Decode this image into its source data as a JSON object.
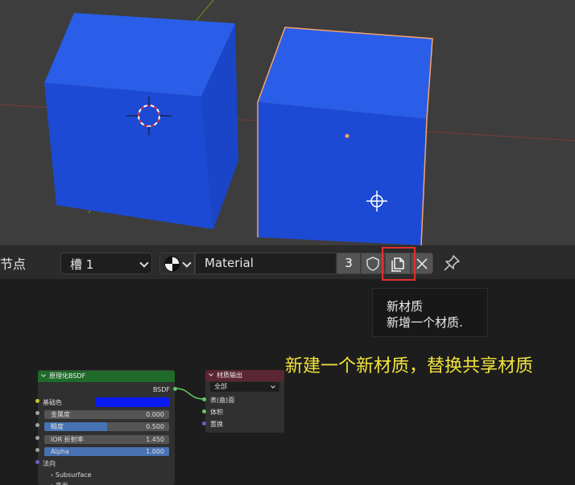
{
  "header": {
    "panel_label": "节点",
    "slot": "槽 1",
    "material_name": "Material",
    "user_count": "3"
  },
  "tooltip": {
    "title": "新材质",
    "description": "新增一个材质."
  },
  "annotation": {
    "caption": "新建一个新材质，替换共享材质",
    "highlight_color": "#e23030",
    "caption_color": "#f2e33b"
  },
  "nodes": {
    "bsdf": {
      "title": "原理化BSDF",
      "output": "BSDF",
      "base_color_label": "基础色",
      "base_color": "#0a1af2",
      "fields": [
        {
          "label": "金属度",
          "value": "0.000",
          "fill": 0
        },
        {
          "label": "糙度",
          "value": "0.500",
          "fill": 0.5
        },
        {
          "label": "IOR 折射率",
          "value": "1.450",
          "fill": 0
        },
        {
          "label": "Alpha",
          "value": "1.000",
          "fill": 1
        }
      ],
      "normal_label": "法向",
      "subsurface_label": "Subsurface",
      "specular_label": "高光"
    },
    "output": {
      "title": "材质输出",
      "target": "全部",
      "inputs": [
        "表(曲)面",
        "体积",
        "置换"
      ]
    }
  },
  "colors": {
    "cube": "#1d4fd8",
    "selection_outline": "#f5a36b",
    "header_bg": "#2b2b2b",
    "viewport_bg": "#3d3d3d"
  }
}
